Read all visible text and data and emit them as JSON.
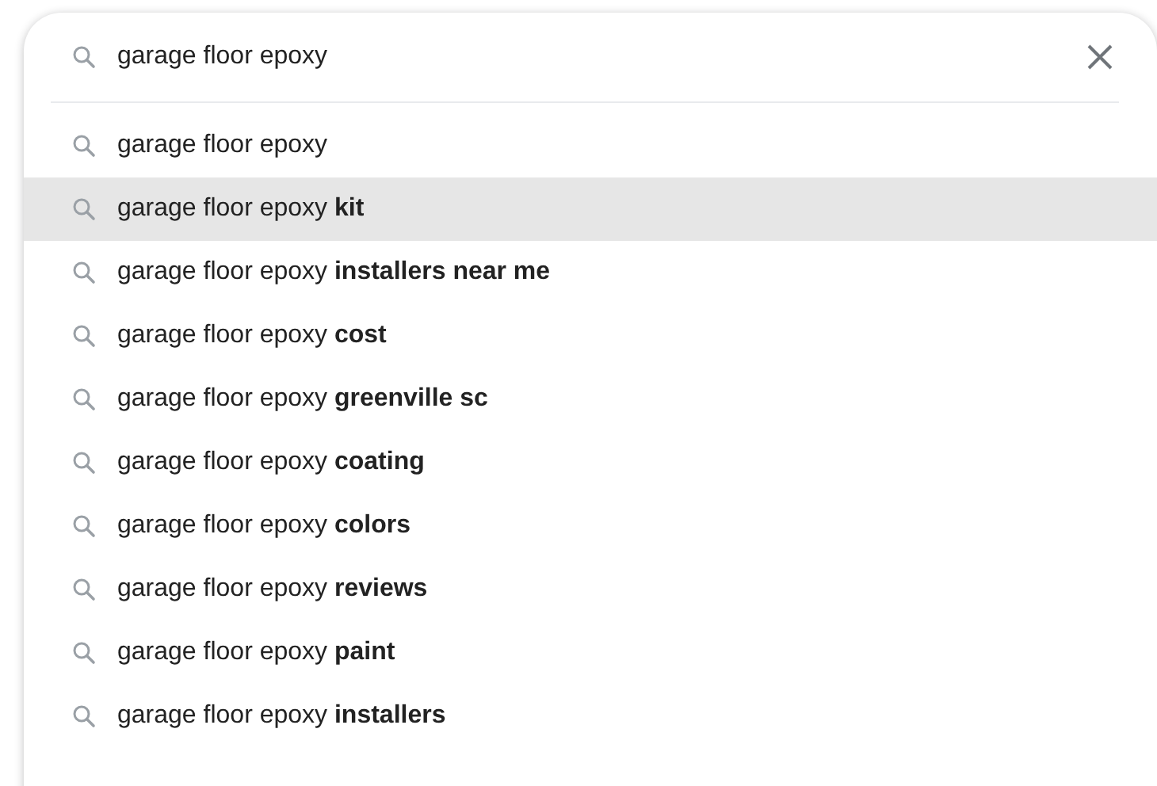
{
  "search": {
    "value": "garage floor epoxy"
  },
  "suggestions": [
    {
      "text": "garage floor epoxy",
      "selected": false
    },
    {
      "text": "garage floor epoxy **kit**",
      "selected": true
    },
    {
      "text": "garage floor epoxy **installers near me**",
      "selected": false
    },
    {
      "text": "garage floor epoxy **cost**",
      "selected": false
    },
    {
      "text": "garage floor epoxy **greenville sc**",
      "selected": false
    },
    {
      "text": "garage floor epoxy **coating**",
      "selected": false
    },
    {
      "text": "garage floor epoxy **colors**",
      "selected": false
    },
    {
      "text": "garage floor epoxy **reviews**",
      "selected": false
    },
    {
      "text": "garage floor epoxy **paint**",
      "selected": false
    },
    {
      "text": "garage floor epoxy **installers**",
      "selected": false
    }
  ]
}
